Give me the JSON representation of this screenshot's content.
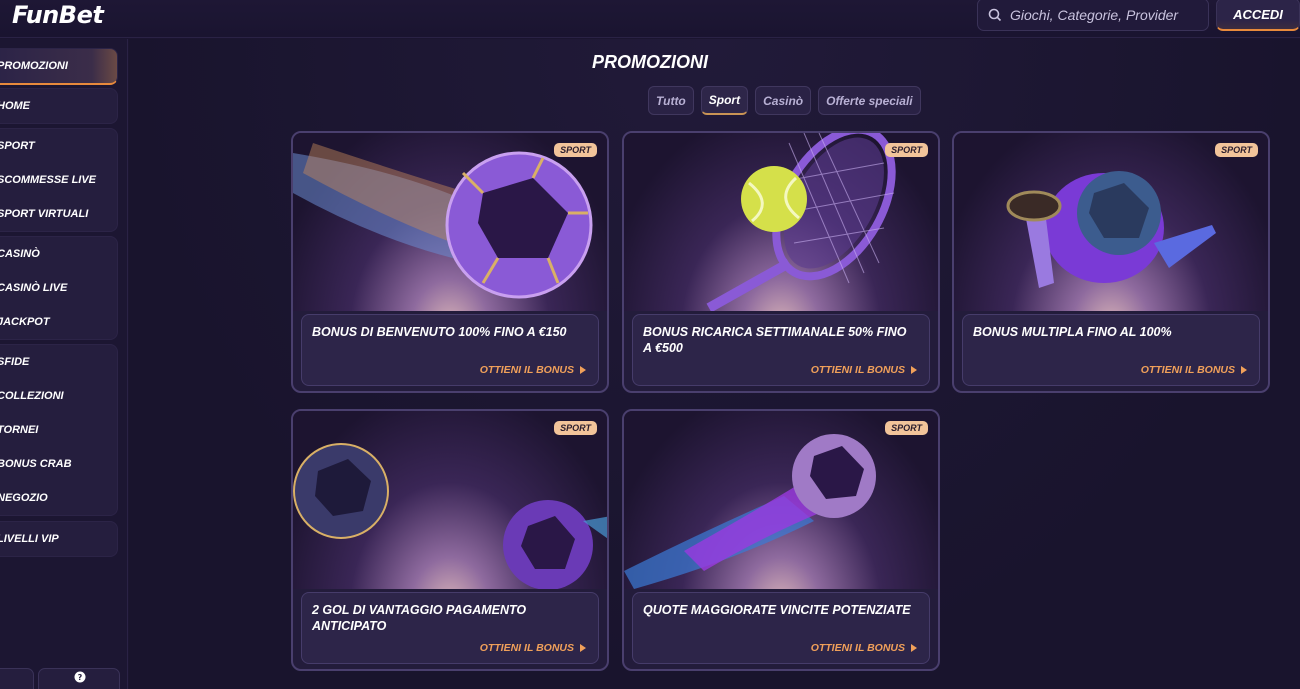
{
  "header": {
    "logo": "FunBet",
    "search_placeholder": "Giochi, Categorie, Provider",
    "login_label": "ACCEDI"
  },
  "sidebar": {
    "groups": [
      {
        "items": [
          "PROMOZIONI"
        ],
        "active": true
      },
      {
        "items": [
          "HOME"
        ]
      },
      {
        "items": [
          "SPORT",
          "SCOMMESSE LIVE",
          "SPORT VIRTUALI"
        ]
      },
      {
        "items": [
          "CASINÒ",
          "CASINÒ LIVE",
          "JACKPOT"
        ]
      },
      {
        "items": [
          "SFIDE",
          "COLLEZIONI",
          "TORNEI",
          "BONUS CRAB",
          "NEGOZIO"
        ]
      },
      {
        "items": [
          "LIVELLI VIP"
        ]
      }
    ]
  },
  "main": {
    "title": "PROMOZIONI",
    "tabs": [
      {
        "label": "Tutto",
        "active": false
      },
      {
        "label": "Sport",
        "active": true
      },
      {
        "label": "Casinò",
        "active": false
      },
      {
        "label": "Offerte speciali",
        "active": false
      }
    ],
    "cards": [
      {
        "badge": "SPORT",
        "title": "BONUS DI BENVENUTO 100% FINO A €150",
        "cta": "OTTIENI IL BONUS",
        "art": "soccer-ball-purple-trail"
      },
      {
        "badge": "SPORT",
        "title": "BONUS RICARICA SETTIMANALE 50% FINO A €500",
        "cta": "OTTIENI IL BONUS",
        "art": "tennis-racket-ball"
      },
      {
        "badge": "SPORT",
        "title": "BONUS MULTIPLA FINO AL 100%",
        "cta": "OTTIENI IL BONUS",
        "art": "trumpet-ball-foam-hand"
      },
      {
        "badge": "SPORT",
        "title": "2 GOL DI VANTAGGIO PAGAMENTO ANTICIPATO",
        "cta": "OTTIENI IL BONUS",
        "art": "two-soccer-balls"
      },
      {
        "badge": "SPORT",
        "title": "QUOTE MAGGIORATE VINCITE POTENZIATE",
        "cta": "OTTIENI IL BONUS",
        "art": "soccer-ball-blue-trail"
      }
    ]
  },
  "colors": {
    "accent": "#e88a3c",
    "cta": "#f0a05a",
    "badge_bg": "#f2c49a",
    "bg": "#1b1530"
  }
}
